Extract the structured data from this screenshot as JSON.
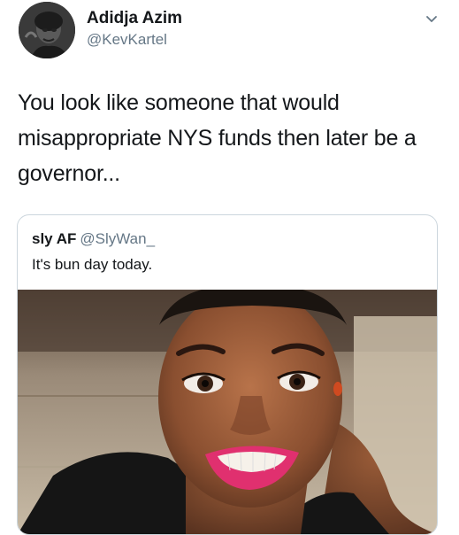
{
  "tweet": {
    "author": {
      "display_name": "Adidja Azim",
      "handle": "@KevKartel"
    },
    "text": "You look like someone that would misappropriate NYS funds then later be a governor...",
    "menu_icon": "chevron-down-icon"
  },
  "quoted_tweet": {
    "display_name": "sly AF",
    "handle": "@SlyWan_",
    "text": "It's bun day today."
  },
  "colors": {
    "secondary_text": "#657786",
    "border": "#ccd6dd",
    "lipstick": "#e0306f"
  }
}
